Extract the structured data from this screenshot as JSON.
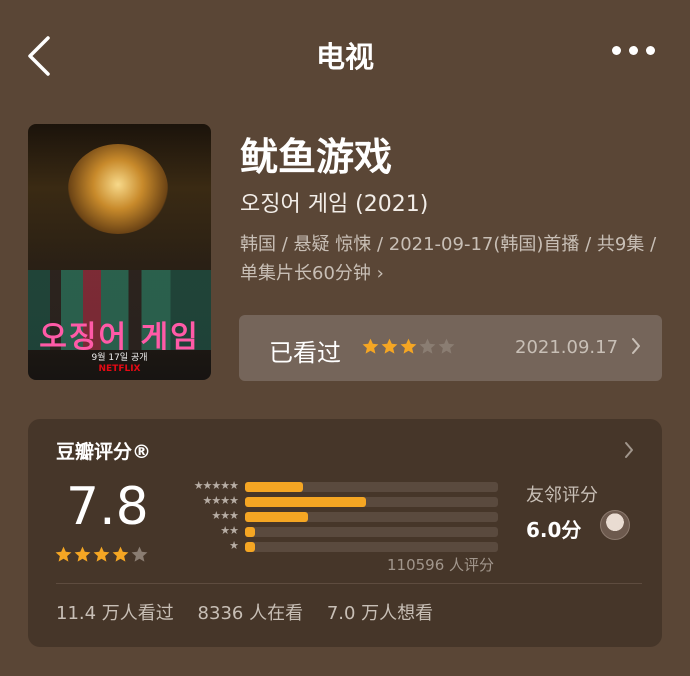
{
  "nav": {
    "title": "电视",
    "back_icon": "chevron-left-icon",
    "more_icon": "more-horizontal-icon"
  },
  "poster": {
    "korean_title": "오징어 게임",
    "subtitle": "9월 17일 공개",
    "brand": "NETFLIX"
  },
  "show": {
    "title": "鱿鱼游戏",
    "original_title": "오징어 게임 (2021)",
    "meta": "韩国 / 悬疑 惊悚 / 2021-09-17(韩国)首播 / 共9集 / 单集片长60分钟",
    "meta_chevron": "›"
  },
  "watched": {
    "label": "已看过",
    "my_rating": 3,
    "max_rating": 5,
    "date": "2021.09.17"
  },
  "rating": {
    "header": "豆瓣评分®",
    "score": "7.8",
    "stars": 4,
    "distribution": [
      {
        "stars": "★★★★★",
        "fraction": 0.23
      },
      {
        "stars": "★★★★",
        "fraction": 0.48
      },
      {
        "stars": "★★★",
        "fraction": 0.25
      },
      {
        "stars": "★★",
        "fraction": 0.04
      },
      {
        "stars": "★",
        "fraction": 0.04
      }
    ],
    "count_text": "110596 人评分",
    "friend_label": "友邻评分",
    "friend_score": "6.0分"
  },
  "stats": {
    "watched": "11.4 万人看过",
    "watching": "8336 人在看",
    "want": "7.0 万人想看"
  },
  "colors": {
    "background": "#5a4636",
    "card": "#463629",
    "accent": "#f5a623"
  }
}
